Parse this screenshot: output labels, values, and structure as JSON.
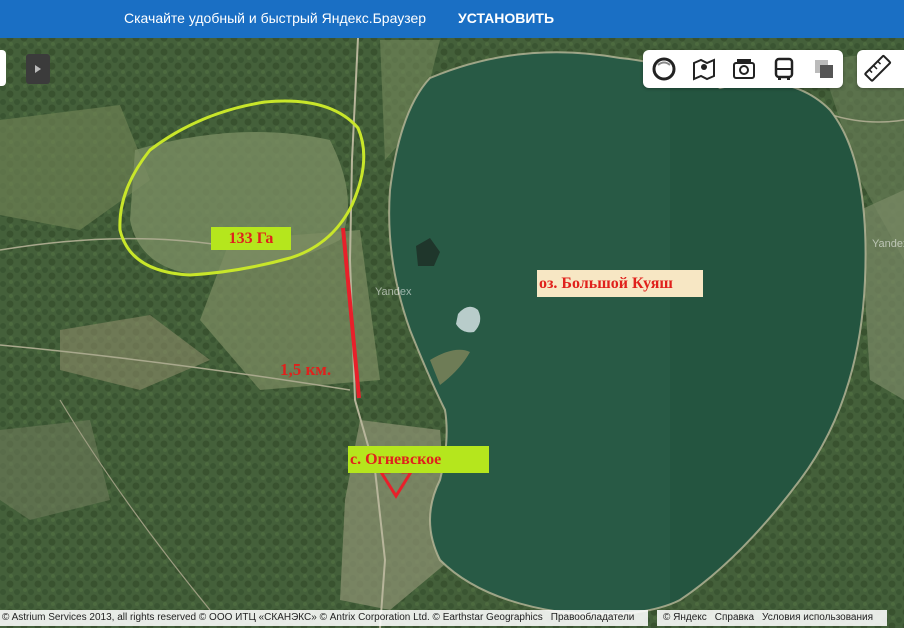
{
  "promo": {
    "message": "Скачайте удобный и быстрый Яндекс.Браузер",
    "install_label": "УСТАНОВИТЬ"
  },
  "map": {
    "labels": {
      "area": "133 Га",
      "lake": "оз. Большой Куяш",
      "distance": "1,5 км.",
      "village": "с. Огневское"
    },
    "watermarks": [
      "Yandex",
      "Yandex"
    ],
    "colors": {
      "boundary": "#c8e62a",
      "route_line": "#e8202a",
      "arrow": "#e8202a",
      "label_text": "#e0211c",
      "label_bg_green": "#b5e61d",
      "label_bg_cream": "#f7e7c4",
      "lake": "#285a45"
    }
  },
  "toolbar": {
    "buttons": [
      "layers-icon",
      "map-icon",
      "panorama-camera-icon",
      "transport-bus-icon",
      "overlay-icon"
    ],
    "ruler": "ruler-icon"
  },
  "footer": {
    "attribution": "© Astrium Services 2013, all rights reserved © ООО ИТЦ «СКАНЭКС» © Antrix Corporation Ltd. © Earthstar Geographics",
    "rights_link": "Правообладатели",
    "copyright": "© Яндекс",
    "help": "Справка",
    "terms": "Условия использования"
  }
}
